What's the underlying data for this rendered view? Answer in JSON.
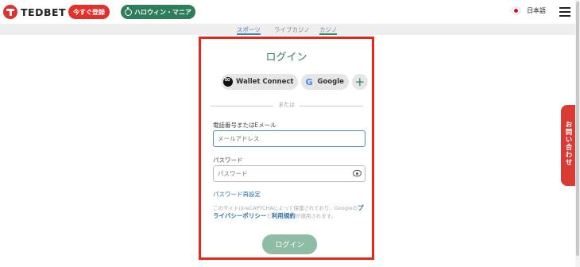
{
  "header": {
    "logo_text": "TEDBET",
    "register_label": "今すぐ登録",
    "promo_label": "ハロウィン・マニア",
    "language": "日本語"
  },
  "subnav": {
    "tabs": [
      {
        "label": "スポーツ"
      },
      {
        "label": "ライブカジノ"
      },
      {
        "label": "カジノ"
      }
    ]
  },
  "contact_tab": "お問い合わせ",
  "login": {
    "title": "ログイン",
    "wallet_connect": "Wallet Connect",
    "google": "Google",
    "more": "+",
    "divider": "または",
    "phone_email_label": "電話番号またはEメール",
    "email_placeholder": "メールアドレス",
    "password_label": "パスワード",
    "password_placeholder": "パスワード",
    "forgot_password": "パスワード再設定",
    "recaptcha_prefix": "このサイトはreCAPTCHAによって保護されており、Googleの",
    "privacy_policy": "プライバシーポリシー",
    "and": "と",
    "terms": "利用規約",
    "recaptcha_suffix": "が適用されます。",
    "submit_label": "ログイン"
  },
  "colors": {
    "brand_red": "#e0312b",
    "brand_green": "#2e7d5b",
    "highlight_border": "#e8261c"
  }
}
